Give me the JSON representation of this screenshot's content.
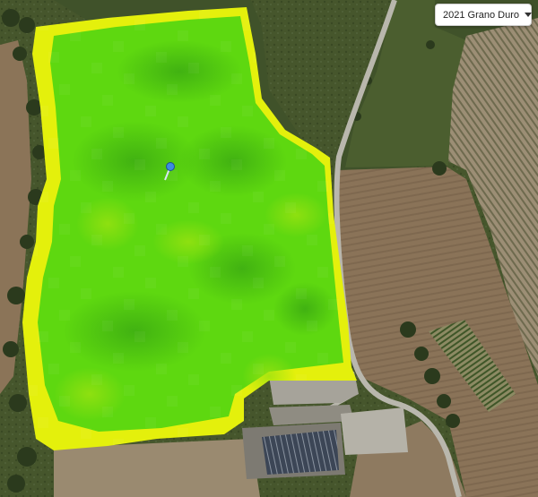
{
  "season_selector": {
    "selected": "2021 Grano Duro",
    "icon": "chevron-down-icon"
  },
  "map": {
    "type": "satellite-field-vigor-map",
    "colors": {
      "vigor_high": "#4ed40a",
      "vigor_mid": "#8ee00e",
      "vigor_low": "#e8f20c",
      "marker": "#3d8be0"
    },
    "marker_icon": "map-pin-icon"
  }
}
